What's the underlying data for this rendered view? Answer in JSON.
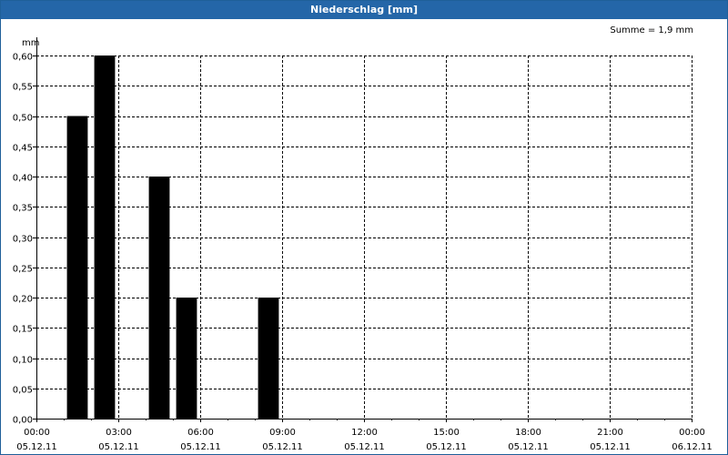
{
  "window": {
    "title": "Niederschlag [mm]"
  },
  "chart_data": {
    "type": "bar",
    "title": "Niederschlag [mm]",
    "unit_label": "mm",
    "annotation": "Summe = 1,9 mm",
    "xlim_hours": [
      0,
      24
    ],
    "ylim": [
      0,
      0.6
    ],
    "grid": true,
    "y_ticks": [
      "0,00",
      "0,05",
      "0,10",
      "0,15",
      "0,20",
      "0,25",
      "0,30",
      "0,35",
      "0,40",
      "0,45",
      "0,50",
      "0,55",
      "0,60"
    ],
    "x_ticks": [
      {
        "time": "00:00",
        "date": "05.12.11"
      },
      {
        "time": "03:00",
        "date": "05.12.11"
      },
      {
        "time": "06:00",
        "date": "05.12.11"
      },
      {
        "time": "09:00",
        "date": "05.12.11"
      },
      {
        "time": "12:00",
        "date": "05.12.11"
      },
      {
        "time": "15:00",
        "date": "05.12.11"
      },
      {
        "time": "18:00",
        "date": "05.12.11"
      },
      {
        "time": "21:00",
        "date": "05.12.11"
      },
      {
        "time": "00:00",
        "date": "06.12.11"
      }
    ],
    "bars": [
      {
        "start": "05.12.11 01:00",
        "end": "05.12.11 02:00",
        "value": 0.5
      },
      {
        "start": "05.12.11 02:00",
        "end": "05.12.11 03:00",
        "value": 0.6
      },
      {
        "start": "05.12.11 04:00",
        "end": "05.12.11 05:00",
        "value": 0.4
      },
      {
        "start": "05.12.11 05:00",
        "end": "05.12.11 06:00",
        "value": 0.2
      },
      {
        "start": "05.12.11 08:00",
        "end": "05.12.11 09:00",
        "value": 0.2
      }
    ],
    "bar_color": "#000000"
  }
}
